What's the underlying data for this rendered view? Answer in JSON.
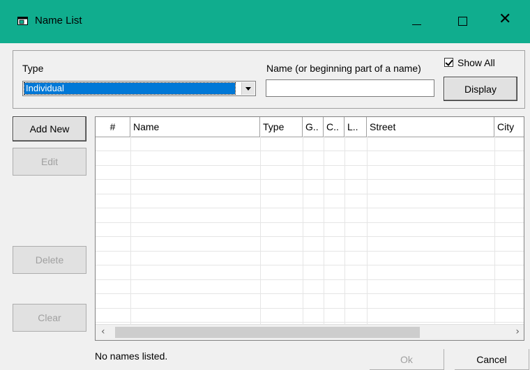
{
  "window": {
    "title": "Name List",
    "controls": [
      "minimize-icon",
      "maximize-icon",
      "close-icon"
    ],
    "accent_color": "#10ad8e"
  },
  "filter": {
    "type_label": "Type",
    "type_value": "Individual",
    "name_label": "Name (or beginning part of a name)",
    "name_value": "",
    "show_all_label": "Show All",
    "show_all_checked": true,
    "display_button": "Display"
  },
  "actions": {
    "add_new": "Add New",
    "edit": "Edit",
    "delete": "Delete",
    "clear": "Clear"
  },
  "grid": {
    "columns": [
      "#",
      "Name",
      "Type",
      "G..",
      "C..",
      "L..",
      "Street",
      "City"
    ],
    "rows": []
  },
  "status": {
    "message": "No names listed."
  },
  "footer": {
    "ok": "Ok",
    "cancel": "Cancel"
  }
}
